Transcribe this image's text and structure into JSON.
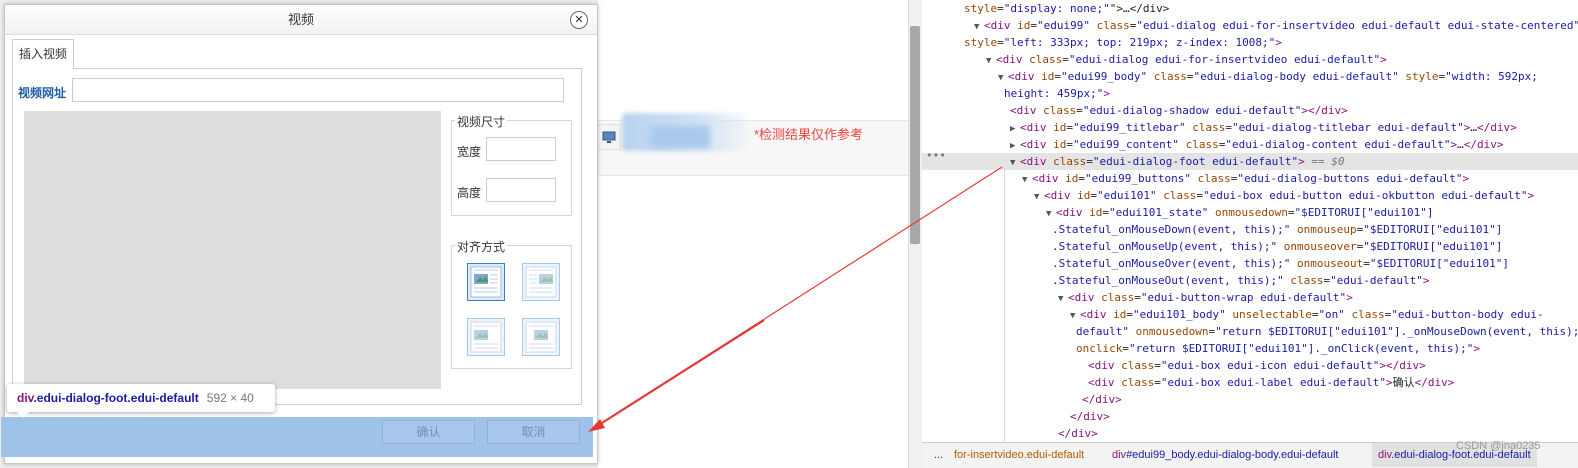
{
  "dialog": {
    "title": "视频",
    "close_glyph": "✕",
    "tab_label": "插入视频",
    "url_label": "视频网址",
    "url_value": "",
    "size_legend": "视频尺寸",
    "width_label": "宽度",
    "width_value": "",
    "height_label": "高度",
    "height_value": "",
    "align_legend": "对齐方式",
    "align_options": [
      {
        "icon": "align-left-icon",
        "selected": true
      },
      {
        "icon": "align-right-icon",
        "selected": false
      },
      {
        "icon": "align-none-icon",
        "selected": false
      },
      {
        "icon": "align-center-icon",
        "selected": false
      }
    ],
    "ok_label": "确认",
    "cancel_label": "取消"
  },
  "tooltip": {
    "tag": "div",
    "classes": ".edui-dialog-foot.edui-default",
    "dimensions": "592 × 40"
  },
  "page": {
    "detect_note": "*检测结果仅作参考"
  },
  "devtools": {
    "lines": [
      {
        "indent": 0,
        "tri": "",
        "segments": [
          [
            "a",
            "style"
          ],
          [
            "x",
            "="
          ],
          [
            "v",
            "\"display: none;\""
          ],
          [
            "x",
            "\">…</div>"
          ]
        ]
      },
      {
        "indent": 1,
        "tri": "▼",
        "segments": [
          [
            "t",
            "<div "
          ],
          [
            "a",
            "id"
          ],
          [
            "x",
            "="
          ],
          [
            "v",
            "\"edui99\""
          ],
          [
            "a",
            " class"
          ],
          [
            "x",
            "="
          ],
          [
            "v",
            "\"edui-dialog edui-for-insertvideo edui-default edui-state-centered\""
          ]
        ]
      },
      {
        "indent": 0,
        "tri": "",
        "segments": [
          [
            "a",
            "style"
          ],
          [
            "x",
            "="
          ],
          [
            "v",
            "\"left: 333px; top: 219px; z-index: 1008;\""
          ],
          [
            "t",
            ">"
          ]
        ]
      },
      {
        "indent": 2,
        "tri": "▼",
        "segments": [
          [
            "t",
            "<div "
          ],
          [
            "a",
            "class"
          ],
          [
            "x",
            "="
          ],
          [
            "v",
            "\"edui-dialog edui-for-insertvideo edui-default\""
          ],
          [
            "t",
            ">"
          ]
        ]
      },
      {
        "indent": 3,
        "tri": "▼",
        "segments": [
          [
            "t",
            "<div "
          ],
          [
            "a",
            "id"
          ],
          [
            "x",
            "="
          ],
          [
            "v",
            "\"edui99_body\""
          ],
          [
            "a",
            " class"
          ],
          [
            "x",
            "="
          ],
          [
            "v",
            "\"edui-dialog-body edui-default\""
          ],
          [
            "a",
            " style"
          ],
          [
            "x",
            "="
          ],
          [
            "v",
            "\"width: 592px;"
          ]
        ]
      },
      {
        "indent": 3.5,
        "tri": "",
        "segments": [
          [
            "v",
            "height: 459px;\""
          ],
          [
            "t",
            ">"
          ]
        ]
      },
      {
        "indent": 4,
        "tri": "",
        "segments": [
          [
            "t",
            "<div "
          ],
          [
            "a",
            "class"
          ],
          [
            "x",
            "="
          ],
          [
            "v",
            "\"edui-dialog-shadow edui-default\""
          ],
          [
            "t",
            "></div>"
          ]
        ]
      },
      {
        "indent": 4,
        "tri": "▶",
        "segments": [
          [
            "t",
            "<div "
          ],
          [
            "a",
            "id"
          ],
          [
            "x",
            "="
          ],
          [
            "v",
            "\"edui99_titlebar\""
          ],
          [
            "a",
            " class"
          ],
          [
            "x",
            "="
          ],
          [
            "v",
            "\"edui-dialog-titlebar edui-default\""
          ],
          [
            "t",
            ">"
          ],
          [
            "x",
            "…"
          ],
          [
            "t",
            "</div>"
          ]
        ]
      },
      {
        "indent": 4,
        "tri": "▶",
        "segments": [
          [
            "t",
            "<div "
          ],
          [
            "a",
            "id"
          ],
          [
            "x",
            "="
          ],
          [
            "v",
            "\"edui99_content\""
          ],
          [
            "a",
            " class"
          ],
          [
            "x",
            "="
          ],
          [
            "v",
            "\"edui-dialog-content edui-default\""
          ],
          [
            "t",
            ">"
          ],
          [
            "x",
            "…"
          ],
          [
            "t",
            "</div>"
          ]
        ]
      },
      {
        "indent": 4,
        "tri": "▼",
        "selected": true,
        "segments": [
          [
            "t",
            "<div "
          ],
          [
            "a",
            "class"
          ],
          [
            "x",
            "="
          ],
          [
            "v",
            "\"edui-dialog-foot edui-default\""
          ],
          [
            "t",
            ">"
          ],
          [
            "eq",
            " == $0"
          ]
        ]
      },
      {
        "indent": 5,
        "tri": "▼",
        "segments": [
          [
            "t",
            "<div "
          ],
          [
            "a",
            "id"
          ],
          [
            "x",
            "="
          ],
          [
            "v",
            "\"edui99_buttons\""
          ],
          [
            "a",
            " class"
          ],
          [
            "x",
            "="
          ],
          [
            "v",
            "\"edui-dialog-buttons edui-default\""
          ],
          [
            "t",
            ">"
          ]
        ]
      },
      {
        "indent": 6,
        "tri": "▼",
        "segments": [
          [
            "t",
            "<div "
          ],
          [
            "a",
            "id"
          ],
          [
            "x",
            "="
          ],
          [
            "v",
            "\"edui101\""
          ],
          [
            "a",
            " class"
          ],
          [
            "x",
            "="
          ],
          [
            "v",
            "\"edui-box edui-button edui-okbutton edui-default\""
          ],
          [
            "t",
            ">"
          ]
        ]
      },
      {
        "indent": 7,
        "tri": "▼",
        "segments": [
          [
            "t",
            "<div "
          ],
          [
            "a",
            "id"
          ],
          [
            "x",
            "="
          ],
          [
            "v",
            "\"edui101_state\""
          ],
          [
            "a",
            " onmousedown"
          ],
          [
            "x",
            "="
          ],
          [
            "v",
            "\"$EDITORUI[\"edui101\"]"
          ]
        ]
      },
      {
        "indent": 7.5,
        "tri": "",
        "segments": [
          [
            "v",
            ".Stateful_onMouseDown(event, this);\""
          ],
          [
            "a",
            " onmouseup"
          ],
          [
            "x",
            "="
          ],
          [
            "v",
            "\"$EDITORUI[\"edui101\"]"
          ]
        ]
      },
      {
        "indent": 7.5,
        "tri": "",
        "segments": [
          [
            "v",
            ".Stateful_onMouseUp(event, this);\""
          ],
          [
            "a",
            " onmouseover"
          ],
          [
            "x",
            "="
          ],
          [
            "v",
            "\"$EDITORUI[\"edui101\"]"
          ]
        ]
      },
      {
        "indent": 7.5,
        "tri": "",
        "segments": [
          [
            "v",
            ".Stateful_onMouseOver(event, this);\""
          ],
          [
            "a",
            " onmouseout"
          ],
          [
            "x",
            "="
          ],
          [
            "v",
            "\"$EDITORUI[\"edui101\"]"
          ]
        ]
      },
      {
        "indent": 7.5,
        "tri": "",
        "segments": [
          [
            "v",
            ".Stateful_onMouseOut(event, this);\""
          ],
          [
            "a",
            " class"
          ],
          [
            "x",
            "="
          ],
          [
            "v",
            "\"edui-default\""
          ],
          [
            "t",
            ">"
          ]
        ]
      },
      {
        "indent": 8,
        "tri": "▼",
        "segments": [
          [
            "t",
            "<div "
          ],
          [
            "a",
            "class"
          ],
          [
            "x",
            "="
          ],
          [
            "v",
            "\"edui-button-wrap edui-default\""
          ],
          [
            "t",
            ">"
          ]
        ]
      },
      {
        "indent": 9,
        "tri": "▼",
        "segments": [
          [
            "t",
            "<div "
          ],
          [
            "a",
            "id"
          ],
          [
            "x",
            "="
          ],
          [
            "v",
            "\"edui101_body\""
          ],
          [
            "a",
            " unselectable"
          ],
          [
            "x",
            "="
          ],
          [
            "v",
            "\"on\""
          ],
          [
            "a",
            " class"
          ],
          [
            "x",
            "="
          ],
          [
            "v",
            "\"edui-button-body edui-"
          ]
        ]
      },
      {
        "indent": 9.5,
        "tri": "",
        "segments": [
          [
            "v",
            "default\""
          ],
          [
            "a",
            " onmousedown"
          ],
          [
            "x",
            "="
          ],
          [
            "v",
            "\"return $EDITORUI[\"edui101\"]._onMouseDown(event, this);\""
          ]
        ]
      },
      {
        "indent": 9.5,
        "tri": "",
        "segments": [
          [
            "a",
            "onclick"
          ],
          [
            "x",
            "="
          ],
          [
            "v",
            "\"return $EDITORUI[\"edui101\"]._onClick(event, this);\""
          ],
          [
            "t",
            ">"
          ]
        ]
      },
      {
        "indent": 10.5,
        "tri": "",
        "segments": [
          [
            "t",
            "<div "
          ],
          [
            "a",
            "class"
          ],
          [
            "x",
            "="
          ],
          [
            "v",
            "\"edui-box edui-icon edui-default\""
          ],
          [
            "t",
            "></div>"
          ]
        ]
      },
      {
        "indent": 10.5,
        "tri": "",
        "segments": [
          [
            "t",
            "<div "
          ],
          [
            "a",
            "class"
          ],
          [
            "x",
            "="
          ],
          [
            "v",
            "\"edui-box edui-label edui-default\""
          ],
          [
            "t",
            ">"
          ],
          [
            "x",
            "确认"
          ],
          [
            "t",
            "</div>"
          ]
        ]
      },
      {
        "indent": 10,
        "tri": "",
        "segments": [
          [
            "t",
            "</div>"
          ]
        ]
      },
      {
        "indent": 9,
        "tri": "",
        "segments": [
          [
            "t",
            "</div>"
          ]
        ]
      },
      {
        "indent": 8,
        "tri": "",
        "segments": [
          [
            "t",
            "</div>"
          ]
        ]
      },
      {
        "indent": 7,
        "tri": "",
        "segments": [
          [
            "t",
            "</div>"
          ]
        ]
      }
    ],
    "breadcrumbs": [
      {
        "text": "...",
        "kind": "plain"
      },
      {
        "text": "for-insertvideo.edui-default",
        "kind": "cls"
      },
      {
        "text": "div#edui99_body.edui-dialog-body.edui-default",
        "kind": "full"
      },
      {
        "text": "div.edui-dialog-foot.edui-default",
        "kind": "full",
        "selected": true
      }
    ],
    "watermark": "CSDN @jna0235"
  },
  "colors": {
    "foot_highlight": "#9fc2e9",
    "arrow": "#e53935",
    "detect_note": "#e8463c"
  }
}
